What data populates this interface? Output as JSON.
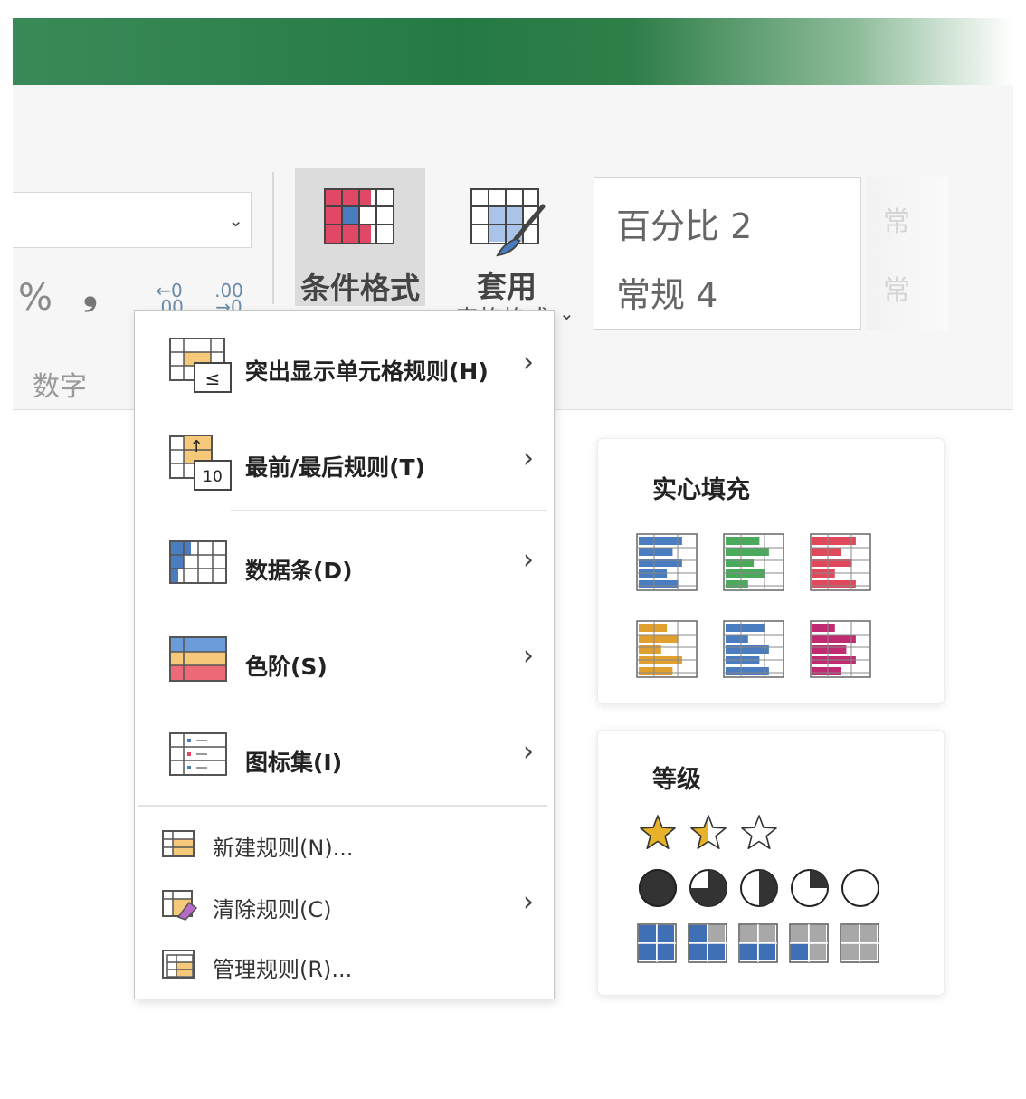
{
  "ribbon": {
    "number_group_label": "数字",
    "percent_glyph": "%",
    "comma_glyph": "❟",
    "increase_decimal": "←0\n.00",
    "decrease_decimal": ".00\n→0",
    "conditional_format_label": "条件格式",
    "format_as_table_label": "套用",
    "format_as_table_label_cut": "表格格式",
    "dropdown_glyph": "⌄",
    "styles": [
      "百分比 2",
      "常规 4"
    ],
    "styles_ghost": [
      "常",
      "常"
    ]
  },
  "menu": {
    "items": [
      {
        "label": "突出显示单元格规则(H)",
        "has_submenu": true
      },
      {
        "label": "最前/最后规则(T)",
        "has_submenu": true,
        "icon_text": "10"
      },
      {
        "label": "数据条(D)",
        "has_submenu": true
      },
      {
        "label": "色阶(S)",
        "has_submenu": true
      },
      {
        "label": "图标集(I)",
        "has_submenu": true
      },
      {
        "label": "新建规则(N)...",
        "has_submenu": false
      },
      {
        "label": "清除规则(C)",
        "has_submenu": true
      },
      {
        "label": "管理规则(R)...",
        "has_submenu": false
      }
    ],
    "highlight_icon_symbol": "≤",
    "top_icon_arrow": "↑",
    "submenu_arrow": "›"
  },
  "data_bars_panel": {
    "title": "实心填充",
    "colors": [
      "#4a7cc0",
      "#4aaa5c",
      "#e0485c",
      "#e0a030",
      "#4a7cc0",
      "#c02a70"
    ]
  },
  "ratings_panel": {
    "title": "等级",
    "stars": [
      "full",
      "half",
      "empty"
    ],
    "pies": [
      "full",
      "three-quarter",
      "half",
      "quarter",
      "empty"
    ],
    "boxes": [
      "4",
      "3",
      "2",
      "1",
      "0"
    ]
  }
}
